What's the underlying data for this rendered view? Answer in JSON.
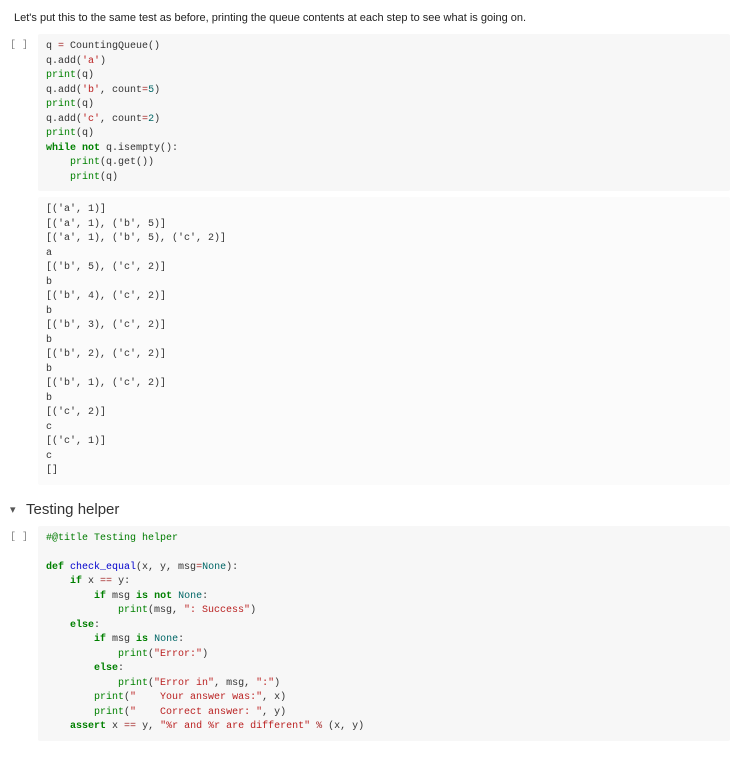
{
  "intro": "Let's put this to the same test as before, printing the queue contents at each step to see what is going on.",
  "prompt_symbol": "[ ]",
  "cell1": {
    "l1a": "q ",
    "l1b": "=",
    "l1c": " CountingQueue()",
    "l2a": "q.add(",
    "l2b": "'a'",
    "l2c": ")",
    "l3a": "print",
    "l3b": "(q)",
    "l4a": "q.add(",
    "l4b": "'b'",
    "l4c": ", count",
    "l4d": "=",
    "l4e": "5",
    "l4f": ")",
    "l5a": "print",
    "l5b": "(q)",
    "l6a": "q.add(",
    "l6b": "'c'",
    "l6c": ", count",
    "l6d": "=",
    "l6e": "2",
    "l6f": ")",
    "l7a": "print",
    "l7b": "(q)",
    "l8a": "while",
    "l8b": " ",
    "l8c": "not",
    "l8d": " q.isempty():",
    "l9a": "    ",
    "l9b": "print",
    "l9c": "(q.get())",
    "l10a": "    ",
    "l10b": "print",
    "l10c": "(q)"
  },
  "output1": "[('a', 1)]\n[('a', 1), ('b', 5)]\n[('a', 1), ('b', 5), ('c', 2)]\na\n[('b', 5), ('c', 2)]\nb\n[('b', 4), ('c', 2)]\nb\n[('b', 3), ('c', 2)]\nb\n[('b', 2), ('c', 2)]\nb\n[('b', 1), ('c', 2)]\nb\n[('c', 2)]\nc\n[('c', 1)]\nc\n[]",
  "section": {
    "arrow": "▾",
    "title": "Testing helper"
  },
  "cell2": {
    "l1a": "#@title Testing helper",
    "blank": "",
    "l2a": "def",
    "l2b": " ",
    "l2c": "check_equal",
    "l2d": "(x, y, msg",
    "l2e": "=",
    "l2f": "None",
    "l2g": "):",
    "l3a": "    ",
    "l3b": "if",
    "l3c": " x ",
    "l3d": "==",
    "l3e": " y:",
    "l4a": "        ",
    "l4b": "if",
    "l4c": " msg ",
    "l4d": "is",
    "l4e": " ",
    "l4f": "not",
    "l4g": " ",
    "l4h": "None",
    "l4i": ":",
    "l5a": "            ",
    "l5b": "print",
    "l5c": "(msg, ",
    "l5d": "\": Success\"",
    "l5e": ")",
    "l6a": "    ",
    "l6b": "else",
    "l6c": ":",
    "l7a": "        ",
    "l7b": "if",
    "l7c": " msg ",
    "l7d": "is",
    "l7e": " ",
    "l7f": "None",
    "l7g": ":",
    "l8a": "            ",
    "l8b": "print",
    "l8c": "(",
    "l8d": "\"Error:\"",
    "l8e": ")",
    "l9a": "        ",
    "l9b": "else",
    "l9c": ":",
    "l10a": "            ",
    "l10b": "print",
    "l10c": "(",
    "l10d": "\"Error in\"",
    "l10e": ", msg, ",
    "l10f": "\":\"",
    "l10g": ")",
    "l11a": "        ",
    "l11b": "print",
    "l11c": "(",
    "l11d": "\"    Your answer was:\"",
    "l11e": ", x)",
    "l12a": "        ",
    "l12b": "print",
    "l12c": "(",
    "l12d": "\"    Correct answer: \"",
    "l12e": ", y)",
    "l13a": "    ",
    "l13b": "assert",
    "l13c": " x ",
    "l13d": "==",
    "l13e": " y, ",
    "l13f": "\"%r and %r are different\"",
    "l13g": " ",
    "l13h": "%",
    "l13i": " (x, y)"
  }
}
